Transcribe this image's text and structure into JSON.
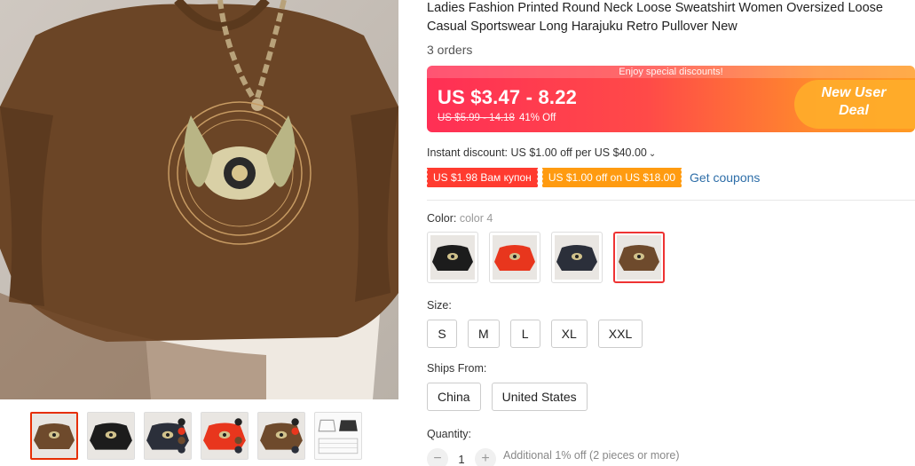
{
  "product": {
    "title": "Ladies Fashion Printed Round Neck Loose Sweatshirt Women Oversized Loose Casual Sportswear Long Harajuku Retro Pullover New",
    "orders": "3 orders"
  },
  "price_banner": {
    "top_text": "Enjoy special discounts!",
    "price": "US $3.47 - 8.22",
    "original_price": "US $5.99 - 14.18",
    "discount": "41% Off",
    "promo": "New User Deal"
  },
  "discounts": {
    "instant": "Instant discount: US $1.00 off per US $40.00",
    "coupons": [
      "US $1.98 Вам купон",
      "US $1.00 off on US $18.00"
    ],
    "get_coupons": "Get coupons"
  },
  "color": {
    "label": "Color:",
    "selected": "color 4",
    "options": [
      {
        "name": "black",
        "hex": "#1c1c1c"
      },
      {
        "name": "red",
        "hex": "#e8361d"
      },
      {
        "name": "navy",
        "hex": "#2b2f3a"
      },
      {
        "name": "brown",
        "hex": "#6e4a2c"
      }
    ],
    "selected_index": 3
  },
  "size": {
    "label": "Size:",
    "options": [
      "S",
      "M",
      "L",
      "XL",
      "XXL"
    ]
  },
  "ships_from": {
    "label": "Ships From:",
    "options": [
      "China",
      "United States"
    ]
  },
  "quantity": {
    "label": "Quantity:",
    "value": "1",
    "minus": "−",
    "plus": "+",
    "note": "Additional 1% off (2 pieces or more)"
  },
  "thumbnails": [
    {
      "name": "brown",
      "hex": "#6e4a2c"
    },
    {
      "name": "black",
      "hex": "#1c1c1c"
    },
    {
      "name": "navy-multi",
      "hex": "#2b2f3a"
    },
    {
      "name": "red-multi",
      "hex": "#e8361d"
    },
    {
      "name": "brown-multi",
      "hex": "#6e4a2c"
    },
    {
      "name": "size-chart",
      "hex": "#f4f4f4"
    }
  ],
  "colors": {
    "accent": "#e62e04",
    "link": "#2e6ea8",
    "coupon_red": "#ff3b2f",
    "coupon_orange": "#ff9b10"
  }
}
